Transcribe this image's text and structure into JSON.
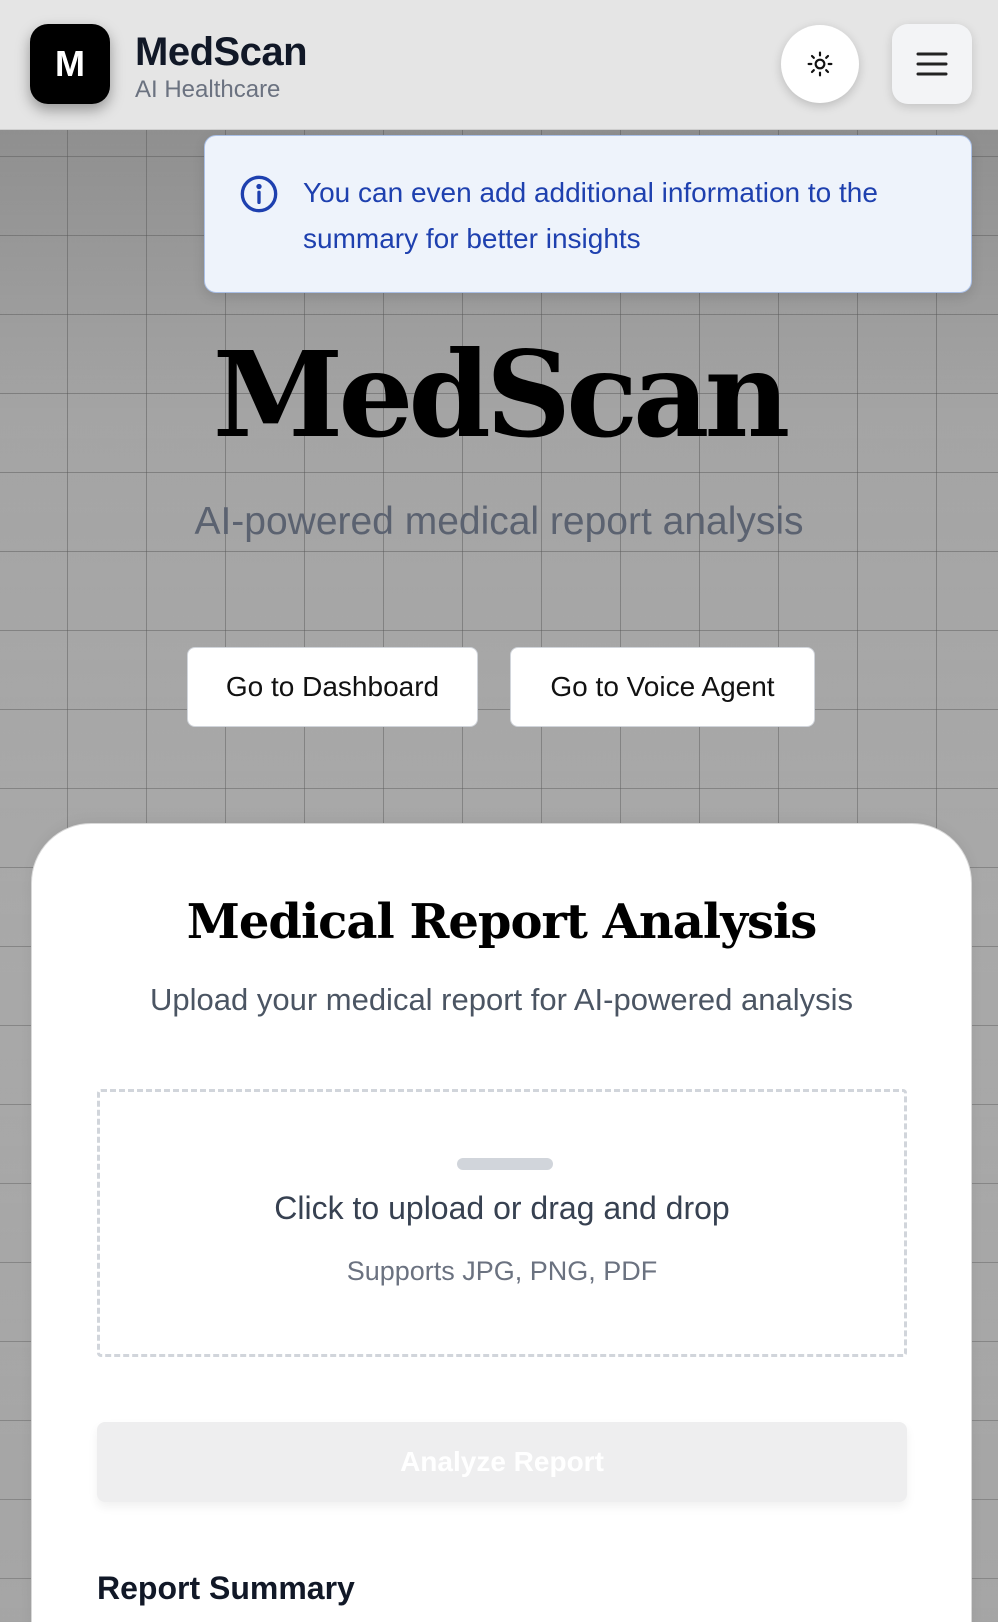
{
  "header": {
    "logo_letter": "M",
    "brand_name": "MedScan",
    "brand_subtitle": "AI Healthcare",
    "theme_toggle_icon": "sun-icon",
    "menu_icon": "hamburger-menu-icon"
  },
  "toast": {
    "icon": "info-icon",
    "message": "You can even add additional information to the summary for better insights",
    "color": "#1e40af"
  },
  "hero": {
    "title": "MedScan",
    "subtitle": "AI-powered medical report analysis",
    "dashboard_button": "Go to Dashboard",
    "voice_agent_button": "Go to Voice Agent"
  },
  "analysis_card": {
    "title": "Medical Report Analysis",
    "subtitle": "Upload your medical report for AI-powered analysis",
    "upload": {
      "title": "Click to upload or drag and drop",
      "formats": "Supports JPG, PNG, PDF"
    },
    "analyze_button": "Analyze Report",
    "summary_heading": "Report Summary"
  }
}
